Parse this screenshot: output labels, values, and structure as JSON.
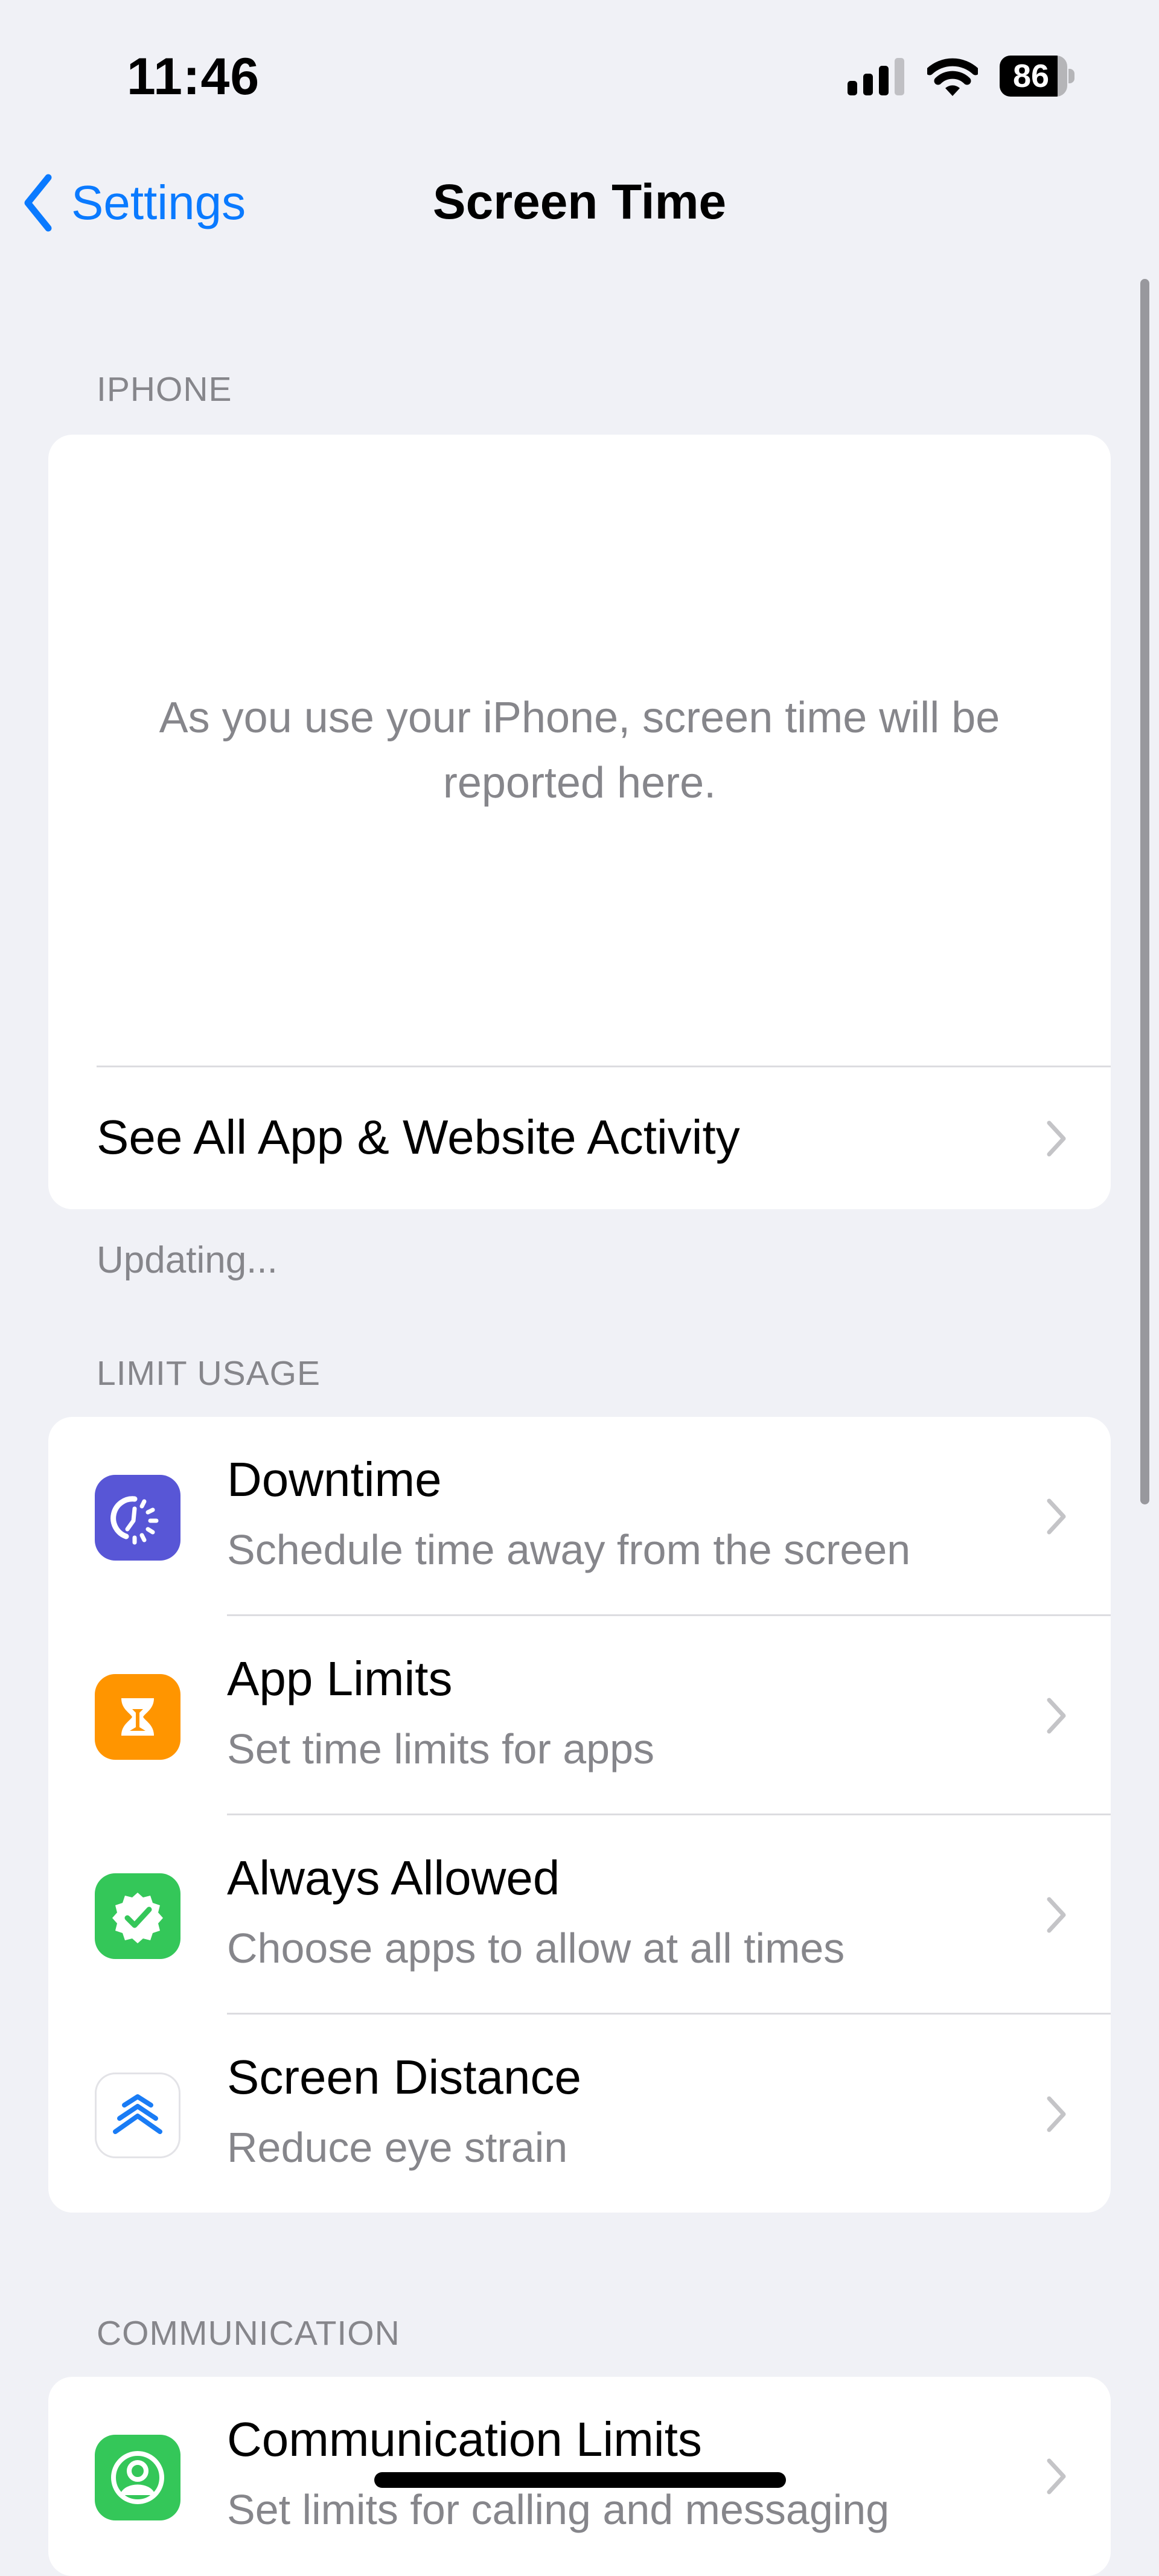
{
  "status_bar": {
    "time": "11:46",
    "battery_percent": "86",
    "battery_level": 0.86,
    "signal_bars_active": 3,
    "signal_bars_total": 4,
    "icons": [
      "cellular-signal-icon",
      "wifi-icon",
      "battery-icon"
    ]
  },
  "nav": {
    "back_label": "Settings",
    "title": "Screen Time"
  },
  "iphone_section": {
    "header": "IPHONE",
    "empty_message": "As you use your iPhone, screen time will be reported here.",
    "activity_link": "See All App & Website Activity",
    "footer": "Updating..."
  },
  "limit_usage": {
    "header": "LIMIT USAGE",
    "items": [
      {
        "title": "Downtime",
        "subtitle": "Schedule time away from the screen",
        "icon": "downtime-icon",
        "icon_color": "#5856d6"
      },
      {
        "title": "App Limits",
        "subtitle": "Set time limits for apps",
        "icon": "hourglass-icon",
        "icon_color": "#ff9500"
      },
      {
        "title": "Always Allowed",
        "subtitle": "Choose apps to allow at all times",
        "icon": "checkmark-seal-icon",
        "icon_color": "#34c759"
      },
      {
        "title": "Screen Distance",
        "subtitle": "Reduce eye strain",
        "icon": "chevrons-up-icon",
        "icon_color": "#ffffff"
      }
    ]
  },
  "communication": {
    "header": "COMMUNICATION",
    "items": [
      {
        "title": "Communication Limits",
        "subtitle": "Set limits for calling and messaging",
        "icon": "person-circle-icon",
        "icon_color": "#34c759"
      }
    ]
  },
  "colors": {
    "accent": "#0a7aff",
    "background": "#f0f1f6",
    "secondary_text": "#86868b"
  }
}
